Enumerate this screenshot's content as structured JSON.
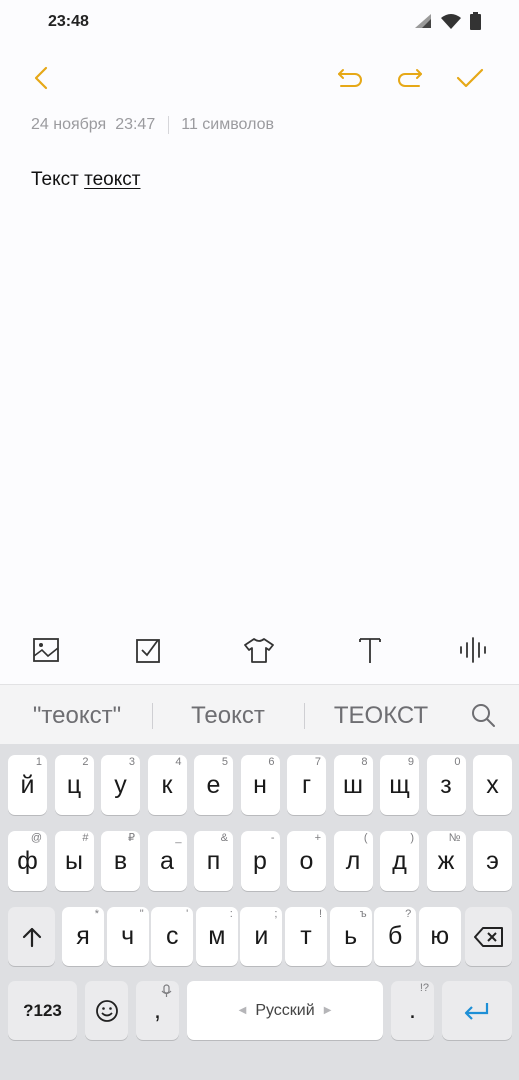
{
  "status_bar": {
    "time": "23:48"
  },
  "colors": {
    "accent": "#e6a817",
    "enter": "#1e8fd6"
  },
  "toolbar": {
    "back_icon": "chevron-left-icon",
    "undo_icon": "undo-icon",
    "redo_icon": "redo-icon",
    "save_icon": "check-icon"
  },
  "meta": {
    "date": "24 ноября",
    "time": "23:47",
    "count": "11 символов"
  },
  "note": {
    "word1": "Текст",
    "word2": "теокст"
  },
  "tools": [
    "image-icon",
    "checkbox-icon",
    "shirt-icon",
    "text-format-icon",
    "voice-icon"
  ],
  "suggestions": [
    "\"теокст\"",
    "Теокст",
    "ТЕОКСТ"
  ],
  "keyboard": {
    "row1": [
      {
        "k": "й",
        "h": "1"
      },
      {
        "k": "ц",
        "h": "2"
      },
      {
        "k": "у",
        "h": "3"
      },
      {
        "k": "к",
        "h": "4"
      },
      {
        "k": "е",
        "h": "5"
      },
      {
        "k": "н",
        "h": "6"
      },
      {
        "k": "г",
        "h": "7"
      },
      {
        "k": "ш",
        "h": "8"
      },
      {
        "k": "щ",
        "h": "9"
      },
      {
        "k": "з",
        "h": "0"
      },
      {
        "k": "х",
        "h": ""
      }
    ],
    "row2": [
      {
        "k": "ф",
        "h": "@"
      },
      {
        "k": "ы",
        "h": "#"
      },
      {
        "k": "в",
        "h": "₽"
      },
      {
        "k": "а",
        "h": "_"
      },
      {
        "k": "п",
        "h": "&"
      },
      {
        "k": "р",
        "h": "-"
      },
      {
        "k": "о",
        "h": "+"
      },
      {
        "k": "л",
        "h": "("
      },
      {
        "k": "д",
        "h": ")"
      },
      {
        "k": "ж",
        "h": "№"
      },
      {
        "k": "э",
        "h": ""
      }
    ],
    "row3": [
      {
        "k": "я",
        "h": "*"
      },
      {
        "k": "ч",
        "h": "\""
      },
      {
        "k": "с",
        "h": "'"
      },
      {
        "k": "м",
        "h": ":"
      },
      {
        "k": "и",
        "h": ";"
      },
      {
        "k": "т",
        "h": "!"
      },
      {
        "k": "ь",
        "h": "ъ"
      },
      {
        "k": "б",
        "h": "?"
      },
      {
        "k": "ю",
        "h": ""
      }
    ],
    "sym_label": "?123",
    "comma": ",",
    "space_label": "Русский",
    "period": ".",
    "period_hint": "!?"
  }
}
